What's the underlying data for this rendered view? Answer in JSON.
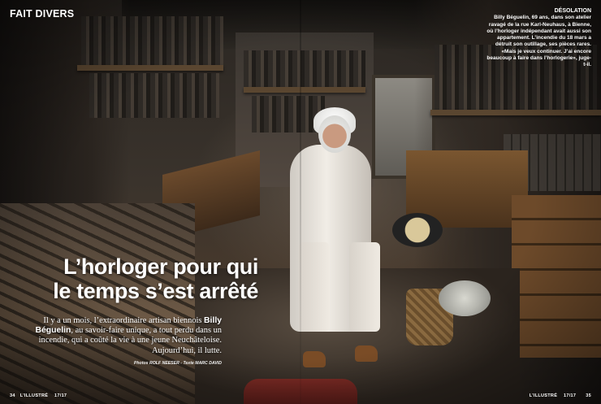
{
  "section": "FAIT DIVERS",
  "caption": {
    "head": "DÉSOLATION",
    "body": "Billy Béguelin, 69 ans, dans son atelier ravagé de la rue Karl-Neuhaus, à Bienne, où l’horloger indépendant avait aussi son appartement. L’incendie du 18 mars a détruit son outillage, ses pièces rares. «Mais je veux continuer. J’ai encore beaucoup à faire dans l’horlogerie», juge-t-il."
  },
  "headline": {
    "line1": "L’horloger pour qui",
    "line2": "le temps s’est arrêté"
  },
  "lead": {
    "before": "Il y a un mois, l’extraordinaire artisan biennois ",
    "name": "Billy Béguelin",
    "after": ", au savoir-faire unique, a tout perdu dans un incendie, qui a coûté la vie à une jeune Neuchâteloise. Aujourd’hui, il lutte."
  },
  "credit": "Photos ROLF NEESER - Texte MARC DAVID",
  "footer": {
    "left_page": "34",
    "left_magazine": "L’ILLUSTRÉ",
    "left_issue": "17/17",
    "right_magazine": "L’ILLUSTRÉ",
    "right_issue": "17/17",
    "right_page": "35"
  }
}
